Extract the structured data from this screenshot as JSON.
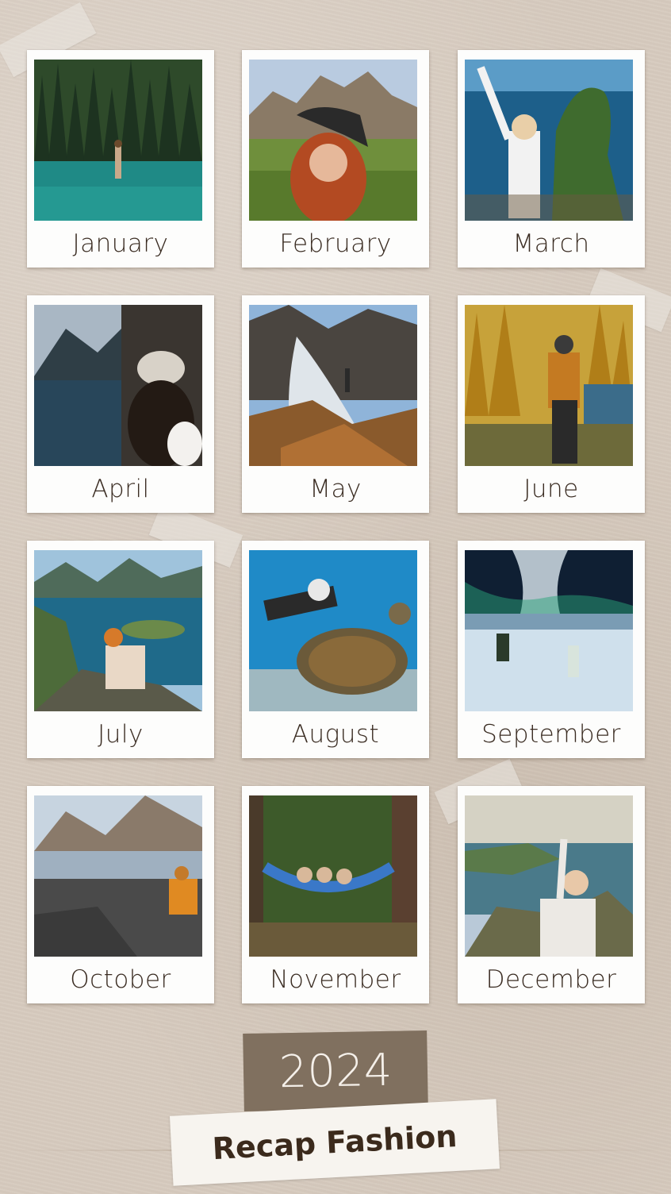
{
  "months": [
    {
      "label": "January"
    },
    {
      "label": "February"
    },
    {
      "label": "March"
    },
    {
      "label": "April"
    },
    {
      "label": "May"
    },
    {
      "label": "June"
    },
    {
      "label": "July"
    },
    {
      "label": "August"
    },
    {
      "label": "September"
    },
    {
      "label": "October"
    },
    {
      "label": "November"
    },
    {
      "label": "December"
    }
  ],
  "year": "2024",
  "title": "Recap Fashion",
  "colors": {
    "background": "#d7cbbf",
    "year_box": "#80705f",
    "text_dark": "#3a2c22"
  }
}
